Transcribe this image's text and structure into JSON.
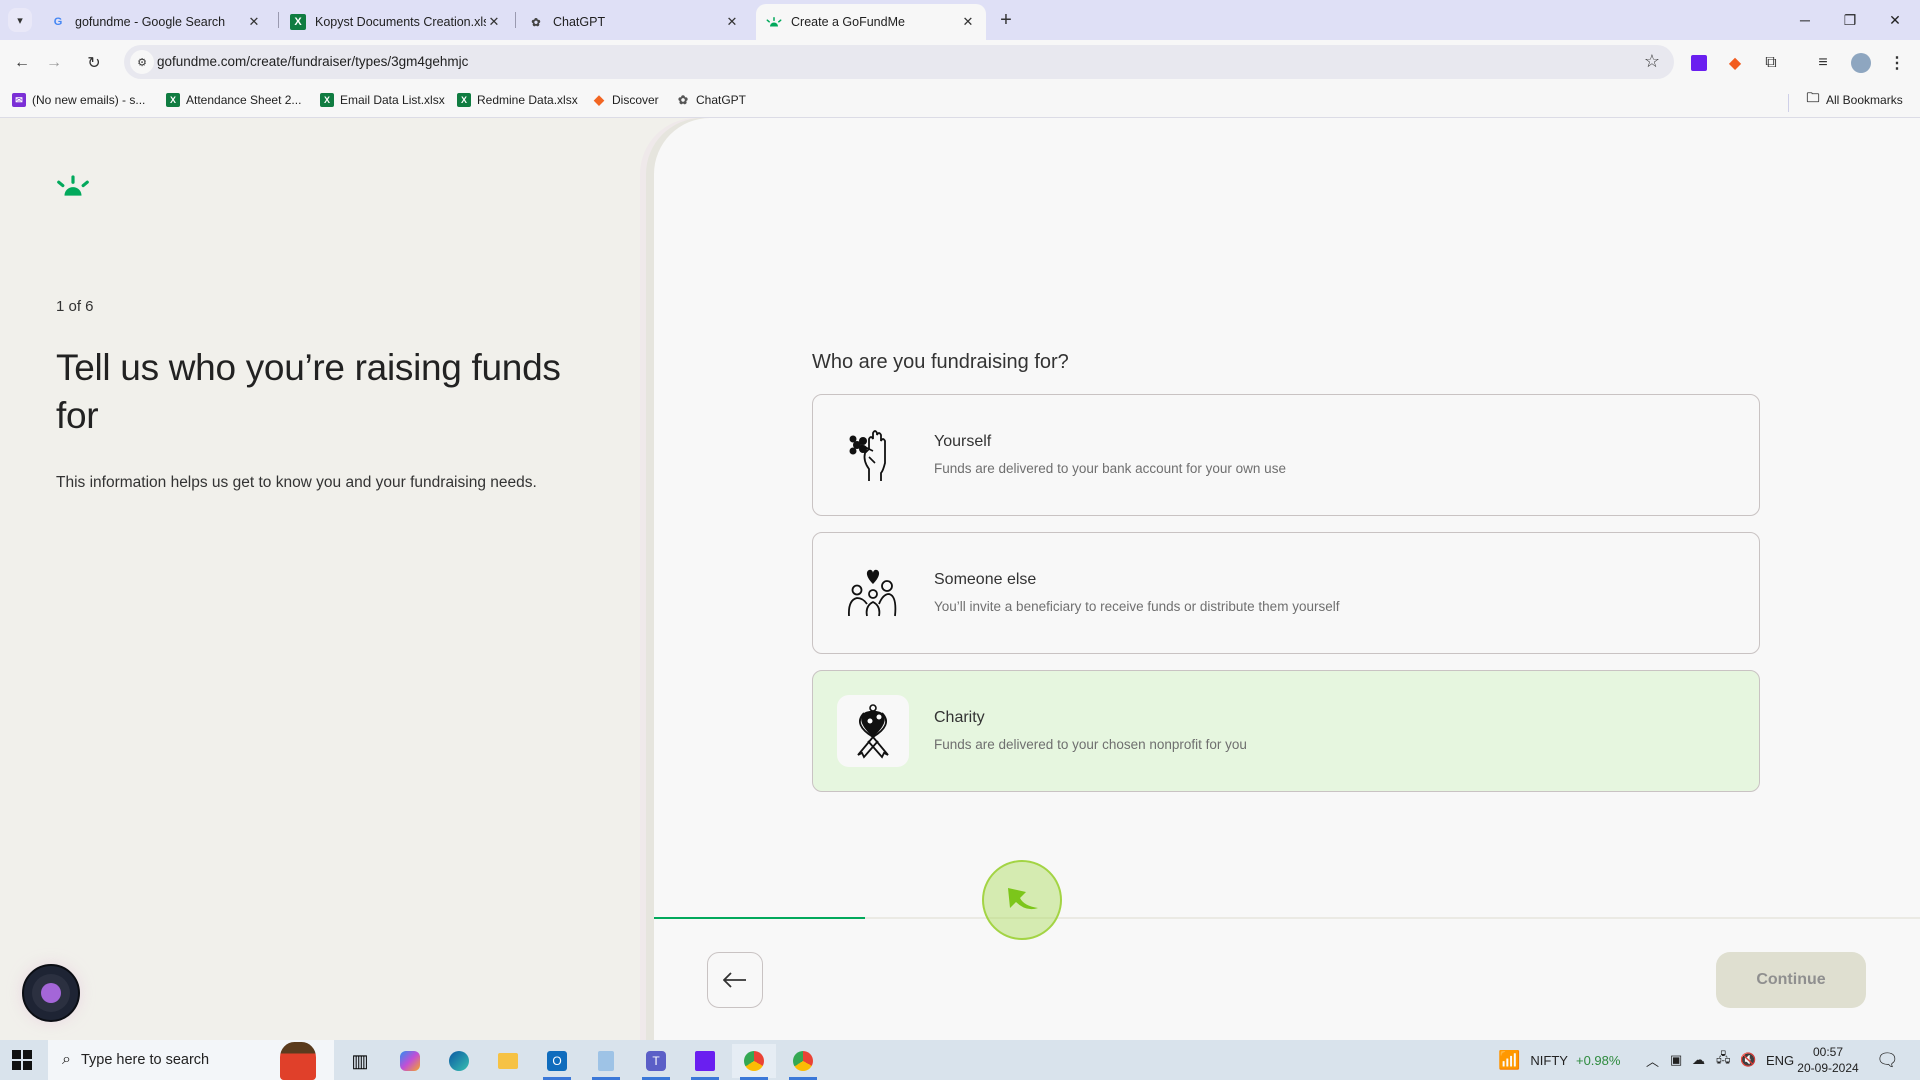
{
  "browser": {
    "tabs": [
      {
        "label": "gofundme - Google Search",
        "icon": "google-icon",
        "active": false
      },
      {
        "label": "Kopyst Documents Creation.xlsx",
        "icon": "excel-icon",
        "active": false
      },
      {
        "label": "ChatGPT",
        "icon": "chatgpt-icon",
        "active": false
      },
      {
        "label": "Create a GoFundMe",
        "icon": "gofundme-icon",
        "active": true
      }
    ],
    "new_tab_label": "+",
    "url": "gofundme.com/create/fundraiser/types/3gm4gehmjc",
    "bookmarks": [
      {
        "label": "(No new emails) - s...",
        "icon": "mail-icon",
        "color": "#7b2fd6"
      },
      {
        "label": "Attendance Sheet 2...",
        "icon": "excel-icon",
        "color": "#107c41"
      },
      {
        "label": "Email Data List.xlsx",
        "icon": "excel-icon",
        "color": "#107c41"
      },
      {
        "label": "Redmine Data.xlsx",
        "icon": "excel-icon",
        "color": "#107c41"
      },
      {
        "label": "Discover",
        "icon": "discover-icon",
        "color": "#f26522"
      },
      {
        "label": "ChatGPT",
        "icon": "chatgpt-icon",
        "color": "#555555"
      }
    ],
    "all_bookmarks_label": "All Bookmarks"
  },
  "page": {
    "step_label": "1 of 6",
    "headline": "Tell us who you’re raising funds for",
    "subtext": "This information helps us get to know you and your fundraising needs.",
    "question": "Who are you fundraising for?",
    "options": [
      {
        "title": "Yourself",
        "description": "Funds are delivered to your bank account for your own use",
        "icon": "hand-flower-icon",
        "selected": false
      },
      {
        "title": "Someone else",
        "description": "You’ll invite a beneficiary to receive funds or distribute them yourself",
        "icon": "family-heart-icon",
        "selected": false
      },
      {
        "title": "Charity",
        "description": "Funds are delivered to your chosen nonprofit for you",
        "icon": "charity-ribbon-icon",
        "selected": true
      }
    ],
    "progress_fraction": 0.1667,
    "continue_label": "Continue",
    "continue_enabled": false,
    "brand_color": "#02a95c",
    "selected_color": "#e6f6df"
  },
  "taskbar": {
    "search_placeholder": "Type here to search",
    "nifty_label": "NIFTY",
    "nifty_change": "+0.98%",
    "language": "ENG",
    "time": "00:57",
    "date": "20-09-2024"
  }
}
